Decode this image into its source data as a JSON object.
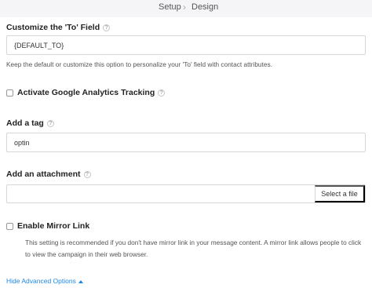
{
  "breadcrumb": {
    "step1": "Setup",
    "step2": "Design"
  },
  "to_field": {
    "label": "Customize the 'To' Field",
    "value": "{DEFAULT_TO}",
    "description": "Keep the default or customize this option to personalize your 'To' field with contact attributes."
  },
  "analytics": {
    "label": "Activate Google Analytics Tracking",
    "checked": false
  },
  "tag": {
    "label": "Add a tag",
    "value": "optin"
  },
  "attachment": {
    "label": "Add an attachment",
    "button": "Select a file"
  },
  "mirror": {
    "label": "Enable Mirror Link",
    "checked": false,
    "description": "This setting is recommended if you don't have mirror link in your message content. A mirror link allows people to click to view the campaign in their web browser."
  },
  "advanced": {
    "link": "Hide Advanced Options"
  },
  "colors": {
    "link": "#1e88e5",
    "topbar_bg": "#f5f5f7"
  }
}
